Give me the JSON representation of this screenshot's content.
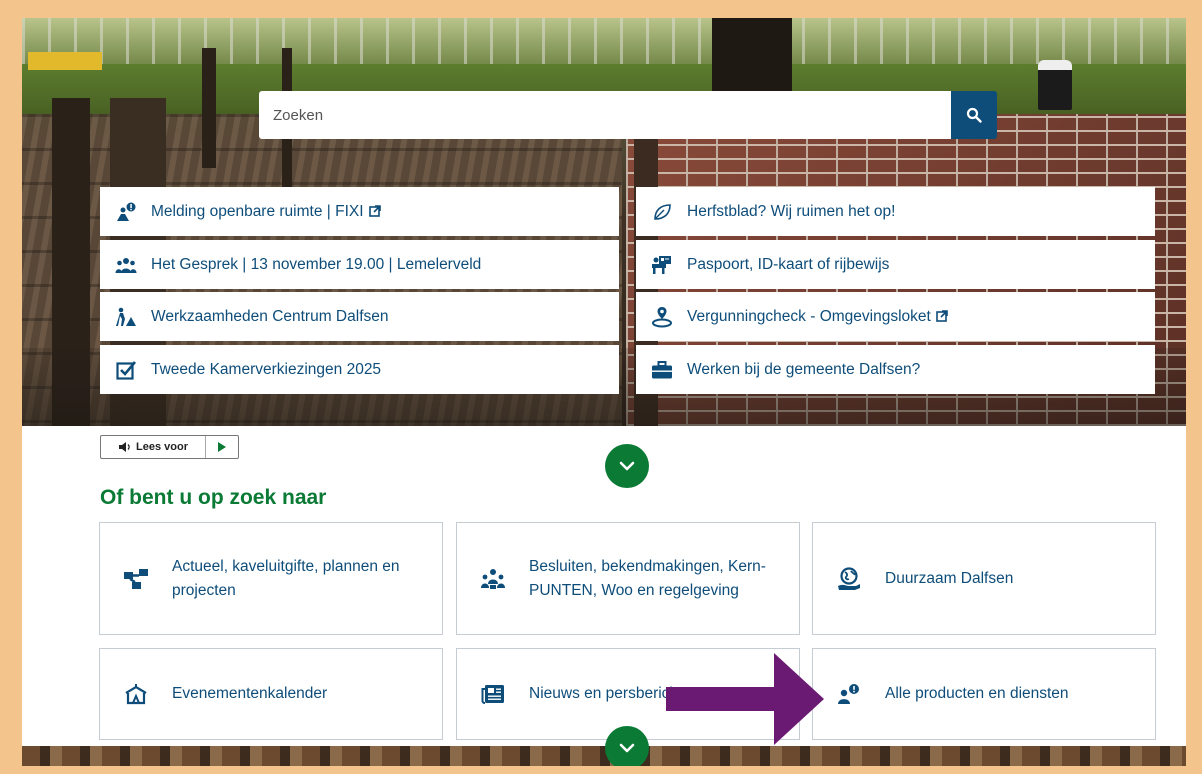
{
  "search": {
    "placeholder": "Zoeken",
    "button_icon": "search-icon"
  },
  "quick_links": [
    {
      "label": "Melding openbare ruimte | FIXI",
      "icon": "report-person-icon",
      "external": true
    },
    {
      "label": "Herfstblad? Wij ruimen het op!",
      "icon": "leaf-icon",
      "external": false
    },
    {
      "label": "Het Gesprek | 13 november 19.00 | Lemelerveld",
      "icon": "people-group-icon",
      "external": false
    },
    {
      "label": "Paspoort, ID-kaart of rijbewijs",
      "icon": "id-desk-icon",
      "external": false
    },
    {
      "label": "Werkzaamheden Centrum Dalfsen",
      "icon": "roadwork-icon",
      "external": false
    },
    {
      "label": "Vergunningcheck - Omgevingsloket",
      "icon": "location-pin-icon",
      "external": true
    },
    {
      "label": "Tweede Kamerverkiezingen 2025",
      "icon": "checkbox-icon",
      "external": false
    },
    {
      "label": "Werken bij de gemeente Dalfsen?",
      "icon": "briefcase-icon",
      "external": false
    }
  ],
  "read_aloud": {
    "label": "Lees voor"
  },
  "section_heading": "Of bent u op zoek naar",
  "cards": [
    {
      "label": "Actueel, kaveluitgifte, plannen en projecten",
      "icon": "sitemap-icon"
    },
    {
      "label": "Besluiten, bekendmakingen, Kern-PUNTEN, Woo en regelgeving",
      "icon": "government-people-icon"
    },
    {
      "label": "Duurzaam Dalfsen",
      "icon": "earth-hand-icon"
    },
    {
      "label": "Evenementenkalender",
      "icon": "tent-icon"
    },
    {
      "label": "Nieuws en persberichten",
      "icon": "newspaper-icon"
    },
    {
      "label": "Alle producten en diensten",
      "icon": "person-info-icon"
    }
  ],
  "colors": {
    "brand_blue": "#0e4d7a",
    "brand_green": "#0a7a35",
    "annotation_arrow": "#6a1a72",
    "frame": "#f3c58d"
  }
}
